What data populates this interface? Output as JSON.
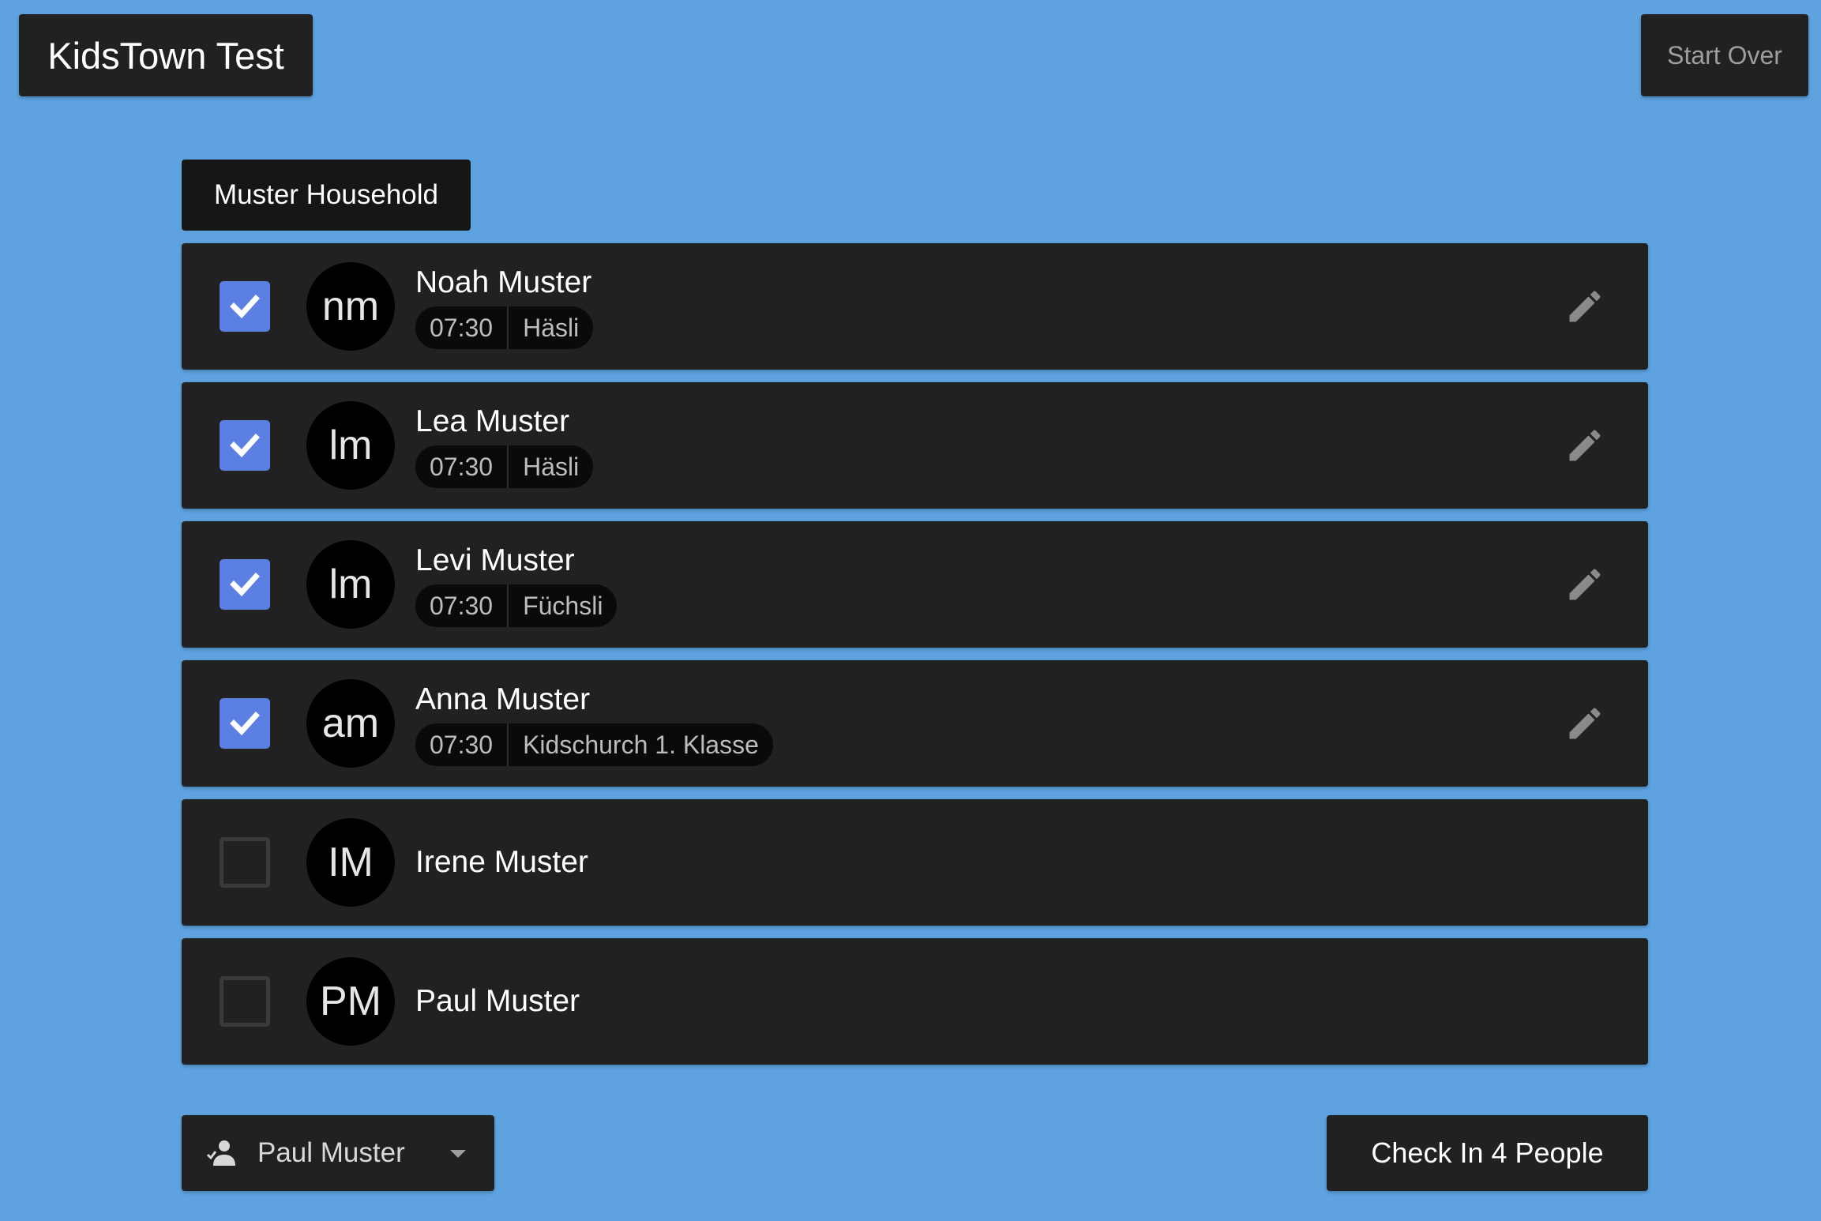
{
  "header": {
    "app_title": "KidsTown Test",
    "start_over_label": "Start Over"
  },
  "household": {
    "name": "Muster Household"
  },
  "people": [
    {
      "initials": "nm",
      "name": "Noah Muster",
      "checked": true,
      "time": "07:30",
      "location": "Häsli",
      "editable": true
    },
    {
      "initials": "lm",
      "name": "Lea Muster",
      "checked": true,
      "time": "07:30",
      "location": "Häsli",
      "editable": true
    },
    {
      "initials": "lm",
      "name": "Levi Muster",
      "checked": true,
      "time": "07:30",
      "location": "Füchsli",
      "editable": true
    },
    {
      "initials": "am",
      "name": "Anna Muster",
      "checked": true,
      "time": "07:30",
      "location": "Kidschurch 1. Klasse",
      "editable": true
    },
    {
      "initials": "IM",
      "name": "Irene Muster",
      "checked": false,
      "time": "",
      "location": "",
      "editable": false
    },
    {
      "initials": "PM",
      "name": "Paul Muster",
      "checked": false,
      "time": "",
      "location": "",
      "editable": false
    }
  ],
  "footer": {
    "selected_user": "Paul Muster",
    "checkin_label": "Check In 4 People"
  },
  "icons": {
    "person": "person-check-icon",
    "caret": "caret-down-icon",
    "edit": "pencil-icon",
    "check": "checkmark-icon"
  },
  "colors": {
    "background": "#5ea3e0",
    "panel": "#212121",
    "checkbox_checked": "#5b7fe3"
  }
}
